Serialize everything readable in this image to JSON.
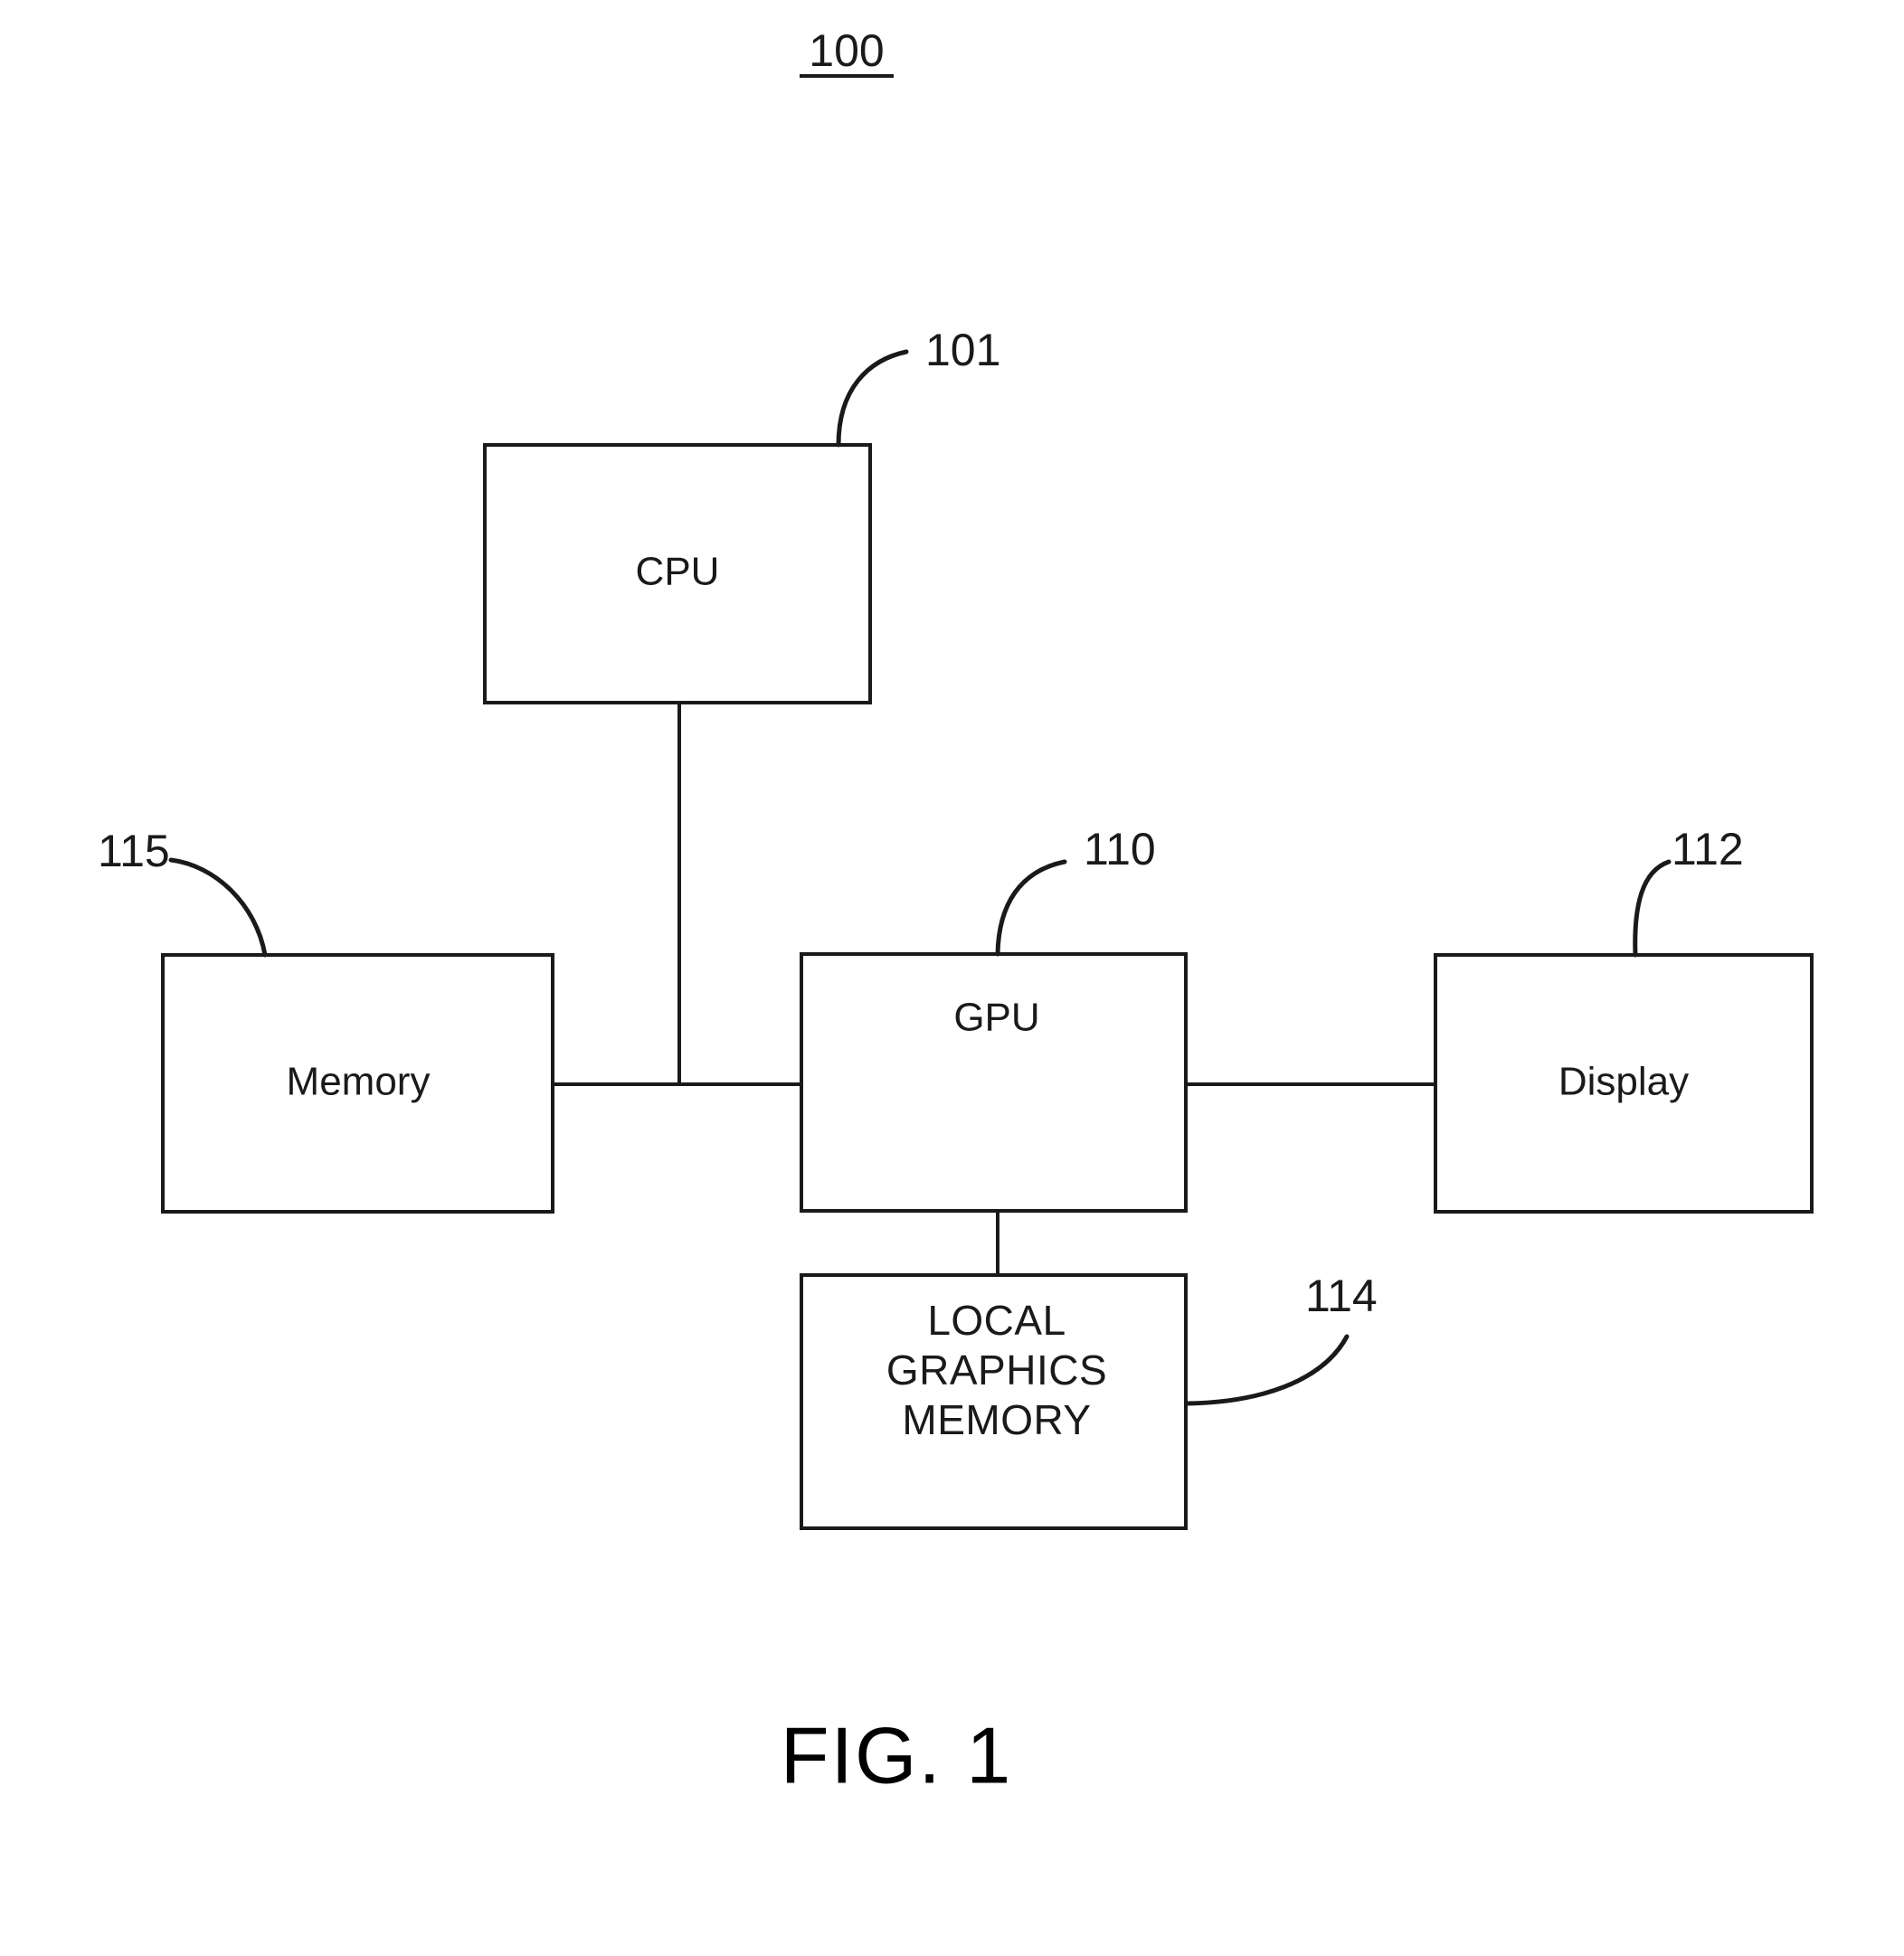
{
  "figure": {
    "title_numeral": "100",
    "caption": "FIG. 1"
  },
  "blocks": [
    {
      "id": "cpu",
      "label": "CPU",
      "ref": "101"
    },
    {
      "id": "memory",
      "label": "Memory",
      "ref": "115"
    },
    {
      "id": "gpu",
      "label": "GPU",
      "ref": "110"
    },
    {
      "id": "display",
      "label": "Display",
      "ref": "112"
    },
    {
      "id": "lgm",
      "label_line1": "LOCAL",
      "label_line2": "GRAPHICS",
      "label_line3": "MEMORY",
      "ref": "114"
    }
  ],
  "colors": {
    "stroke": "#1a1a1a",
    "background": "#ffffff",
    "text": "#000000"
  }
}
